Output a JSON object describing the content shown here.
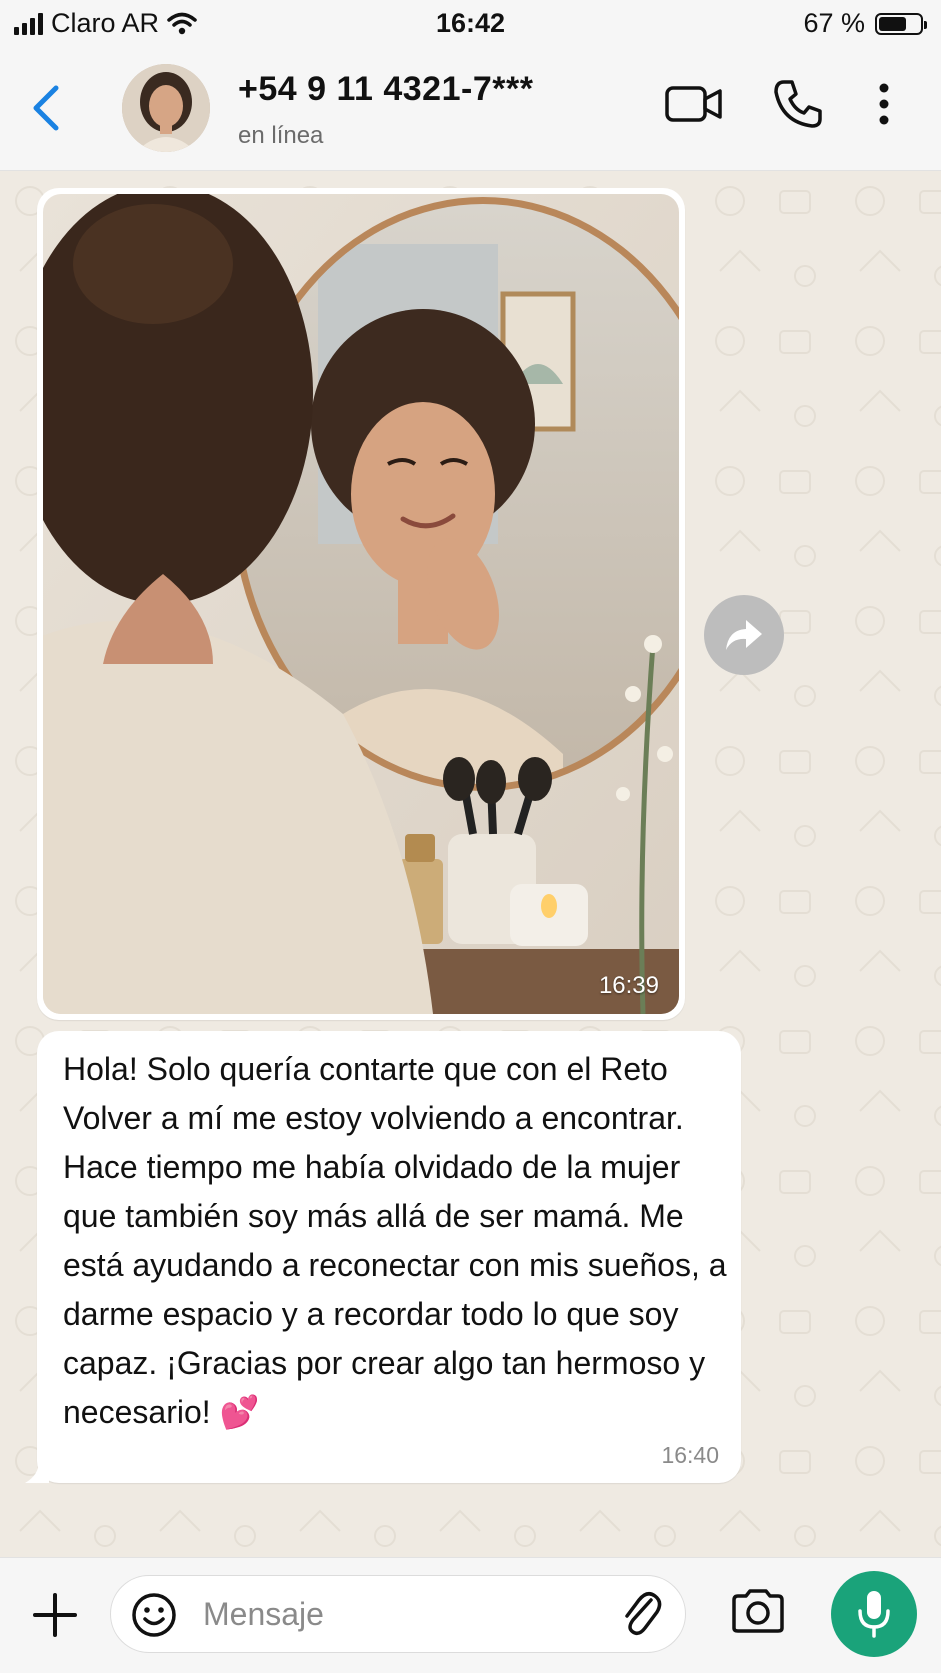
{
  "status_bar": {
    "carrier": "Claro AR",
    "time": "16:42",
    "battery": "67 %",
    "battery_level": 0.67
  },
  "header": {
    "contact_name": "+54 9 11 4321-7***",
    "contact_status": "en línea",
    "icons": [
      "back-chevron-icon",
      "video-call-icon",
      "phone-icon",
      "more-options-icon"
    ]
  },
  "messages": [
    {
      "type": "image",
      "time": "16:39",
      "direction": "incoming"
    },
    {
      "type": "text",
      "direction": "incoming",
      "text": "Hola! Solo quería contarte que con el Reto Volver a mí me estoy volviendo a encontrar. Hace tiempo me había olvidado de la mujer que también soy más allá de ser mamá. Me está ayudando a reconectar con mis sueños, a darme espacio y a recordar todo lo que soy capaz. ¡Gracias por crear algo tan hermoso y necesario!",
      "emoji": "💕",
      "time": "16:40"
    }
  ],
  "input": {
    "placeholder": "Mensaje"
  },
  "colors": {
    "accent": "#1aa37a",
    "back_arrow": "#1a82e2",
    "chat_bg": "#efeae2",
    "bubble_bg": "#ffffff"
  }
}
